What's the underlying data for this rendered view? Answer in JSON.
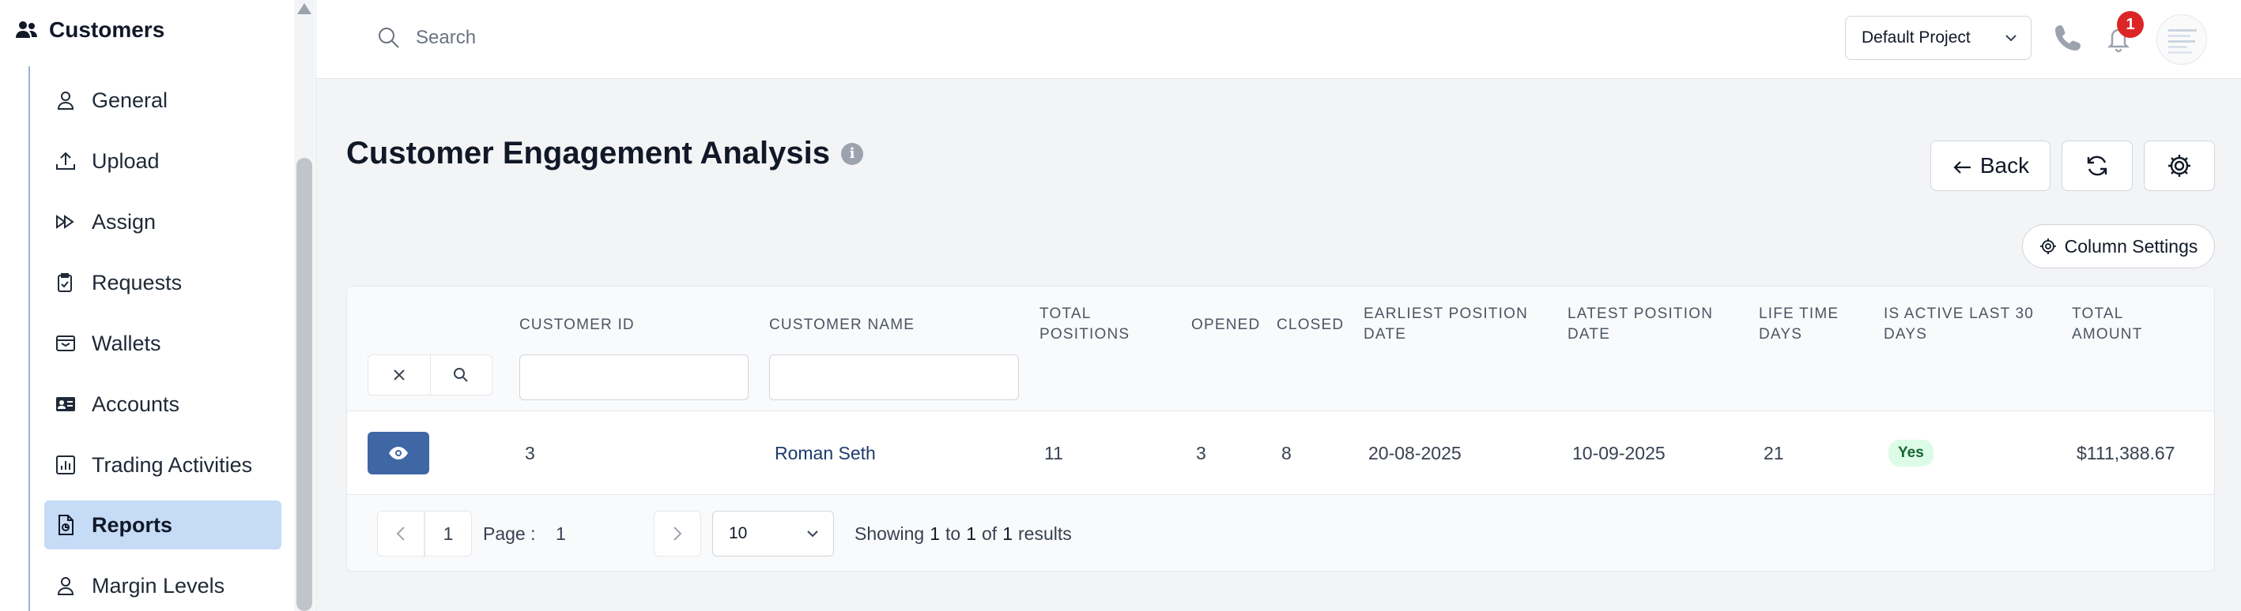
{
  "sidebar": {
    "header": "Customers",
    "items": [
      {
        "label": "General",
        "icon": "user-icon"
      },
      {
        "label": "Upload",
        "icon": "upload-icon"
      },
      {
        "label": "Assign",
        "icon": "fast-forward-icon"
      },
      {
        "label": "Requests",
        "icon": "clipboard-check-icon"
      },
      {
        "label": "Wallets",
        "icon": "wallet-icon"
      },
      {
        "label": "Accounts",
        "icon": "id-card-icon"
      },
      {
        "label": "Trading Activities",
        "icon": "bar-chart-icon"
      },
      {
        "label": "Reports",
        "icon": "report-file-icon",
        "active": true
      },
      {
        "label": "Margin Levels",
        "icon": "user-icon"
      }
    ]
  },
  "topbar": {
    "search_placeholder": "Search",
    "project": "Default Project",
    "notification_count": "1"
  },
  "page": {
    "title": "Customer Engagement Analysis",
    "back_label": "Back",
    "column_settings_label": "Column Settings"
  },
  "table": {
    "columns": [
      {
        "line1": "CUSTOMER ID",
        "line2": ""
      },
      {
        "line1": "CUSTOMER NAME",
        "line2": ""
      },
      {
        "line1": "TOTAL",
        "line2": "POSITIONS"
      },
      {
        "line1": "OPENED",
        "line2": ""
      },
      {
        "line1": "CLOSED",
        "line2": ""
      },
      {
        "line1": "EARLIEST POSITION",
        "line2": "DATE"
      },
      {
        "line1": "LATEST POSITION",
        "line2": "DATE"
      },
      {
        "line1": "LIFE TIME",
        "line2": "DAYS"
      },
      {
        "line1": "IS ACTIVE LAST 30",
        "line2": "DAYS"
      },
      {
        "line1": "TOTAL",
        "line2": "AMOUNT"
      }
    ],
    "rows": [
      {
        "customer_id": "3",
        "customer_name": "Roman Seth",
        "total_positions": "11",
        "opened": "3",
        "closed": "8",
        "earliest_position_date": "20-08-2025",
        "latest_position_date": "10-09-2025",
        "life_time_days": "21",
        "is_active_last_30_days": "Yes",
        "total_amount": "$111,388.67"
      }
    ]
  },
  "pagination": {
    "current_page": "1",
    "page_label": "Page :",
    "page_value": "1",
    "per_page": "10",
    "summary_prefix": "Showing",
    "from": "1",
    "to_word": "to",
    "to": "1",
    "of_word": "of",
    "total": "1",
    "results_word": "results"
  },
  "colors": {
    "primary": "#3f67a6",
    "active_nav": "#c6dbf6",
    "badge_red": "#dc2626",
    "success_bg": "#dcfce7"
  }
}
